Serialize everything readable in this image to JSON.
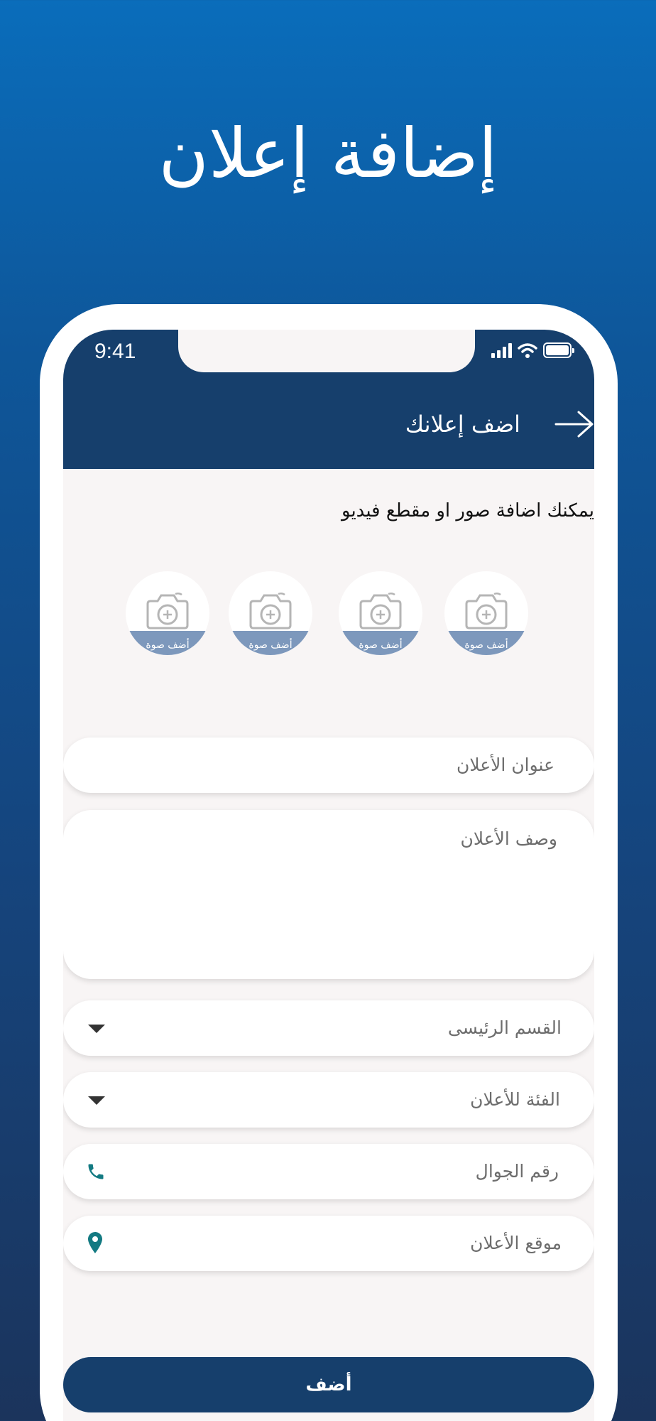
{
  "promo": {
    "title": "إضافة إعلان"
  },
  "status_bar": {
    "time": "9:41"
  },
  "nav": {
    "title": "اضف إعلانك"
  },
  "media": {
    "hint": "يمكنك اضافة صور او مقطع فيديو",
    "slots": [
      {
        "label": "أضف صوة"
      },
      {
        "label": "أضف صوة"
      },
      {
        "label": "أضف صوة"
      },
      {
        "label": "أضف صوة"
      }
    ]
  },
  "form": {
    "title_placeholder": "عنوان الأعلان",
    "description_placeholder": "وصف الأعلان",
    "main_section_placeholder": "القسم الرئيسى",
    "category_placeholder": "الفئة للأعلان",
    "phone_placeholder": "رقم الجوال",
    "location_placeholder": "موقع الأعلان",
    "submit_label": "أضف"
  },
  "colors": {
    "primary": "#163f6c",
    "accent_icon": "#137a82",
    "photo_band": "#7d98bc"
  }
}
